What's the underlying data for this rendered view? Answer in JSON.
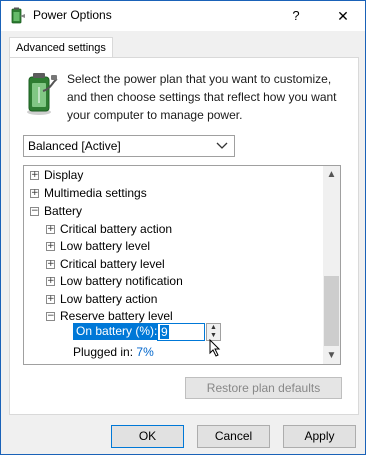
{
  "window": {
    "title": "Power Options",
    "help_label": "?",
    "close_label": "✕"
  },
  "tabs": [
    {
      "label": "Advanced settings"
    }
  ],
  "intro": {
    "lines": [
      "Select the power plan that you want to customize,",
      "and then choose settings that reflect how you want",
      "your computer to manage power."
    ]
  },
  "plan_select": {
    "value": "Balanced [Active]"
  },
  "tree": {
    "items": [
      {
        "label": "Display",
        "expander": "+"
      },
      {
        "label": "Multimedia settings",
        "expander": "+"
      },
      {
        "label": "Battery",
        "expander": "−"
      },
      {
        "label": "Critical battery action",
        "expander": "+"
      },
      {
        "label": "Low battery level",
        "expander": "+"
      },
      {
        "label": "Critical battery level",
        "expander": "+"
      },
      {
        "label": "Low battery notification",
        "expander": "+"
      },
      {
        "label": "Low battery action",
        "expander": "+"
      },
      {
        "label": "Reserve battery level",
        "expander": "−"
      }
    ],
    "on_battery_label": "On battery (%):",
    "on_battery_value": "9",
    "plugged_label": "Plugged in:",
    "plugged_value": "7%"
  },
  "buttons": {
    "restore": "Restore plan defaults",
    "ok": "OK",
    "cancel": "Cancel",
    "apply": "Apply"
  },
  "icons": {
    "app": "power-options-icon",
    "battery": "battery-plug-icon",
    "chevron": "chevron-down-icon",
    "scroll_up": "scroll-up-icon",
    "scroll_down": "scroll-down-icon",
    "cursor": "mouse-pointer-icon"
  },
  "colors": {
    "accent": "#0078d7",
    "link_value": "#0066cc",
    "window_border": "#1a62b8"
  }
}
